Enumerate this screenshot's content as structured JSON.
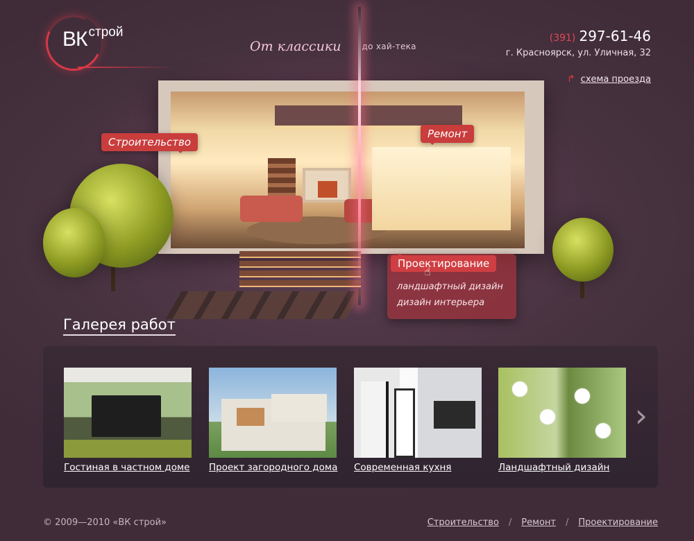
{
  "brand": {
    "mark": "ВК",
    "word": "строй"
  },
  "slogan": {
    "script": "От классики",
    "tail": "до хай-тека"
  },
  "contact": {
    "code": "(391)",
    "phone": "297-61-46",
    "address": "г. Красноярск, ул. Уличная, 32",
    "route_label": "схема проезда"
  },
  "hero_tags": {
    "construction": "Строительство",
    "repair": "Ремонт",
    "design": "Проектирование"
  },
  "design_menu": [
    "ландшафтный дизайн",
    "дизайн интерьера"
  ],
  "gallery": {
    "title": "Галерея работ",
    "items": [
      {
        "label": "Гостиная в частном доме"
      },
      {
        "label": "Проект загородного дома"
      },
      {
        "label": "Современная кухня"
      },
      {
        "label": "Ландшафтный дизайн"
      }
    ],
    "next_symbol": "›"
  },
  "footer": {
    "copyright": "© 2009—2010 «ВК строй»",
    "links": [
      "Строительство",
      "Ремонт",
      "Проектирование"
    ],
    "separator": "/"
  },
  "colors": {
    "accent": "#c93d3d",
    "background": "#4a3444"
  },
  "icons": {
    "route": "route-arrow-icon",
    "next": "chevron-right-icon",
    "cursor": "hand-cursor-icon"
  }
}
